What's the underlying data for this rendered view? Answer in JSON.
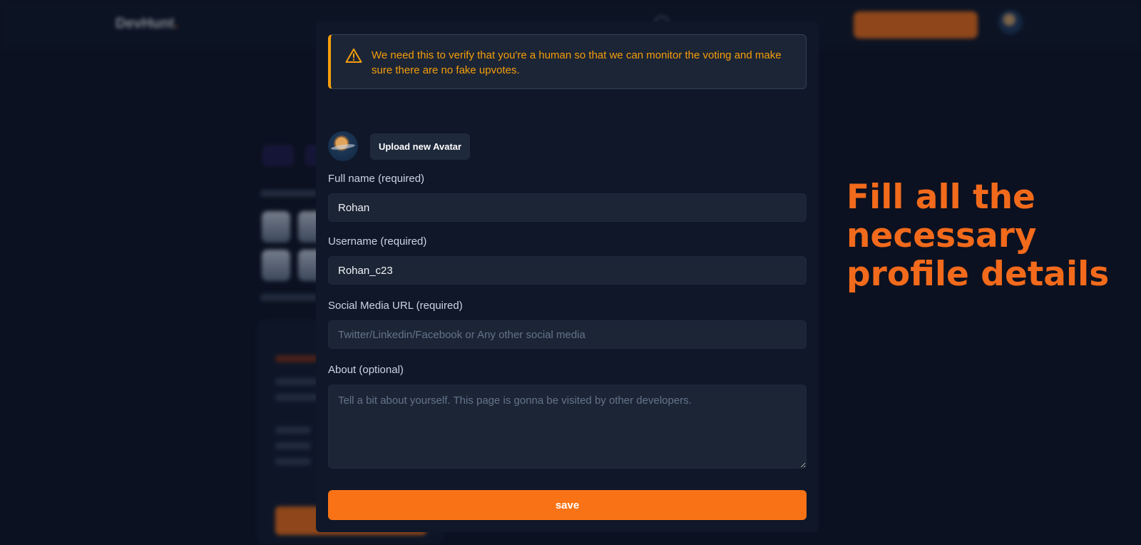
{
  "background": {
    "logo_main": "DevHunt",
    "logo_dot": "."
  },
  "modal": {
    "alert": {
      "icon": "warning-triangle-icon",
      "text": "We need this to verify that you're a human so that we can monitor the voting and make sure there are no fake upvotes."
    },
    "avatar": {
      "upload_label": "Upload new Avatar"
    },
    "fields": {
      "full_name": {
        "label": "Full name (required)",
        "value": "Rohan"
      },
      "username": {
        "label": "Username (required)",
        "value": "Rohan_c23"
      },
      "social": {
        "label": "Social Media URL (required)",
        "value": "",
        "placeholder": "Twitter/Linkedin/Facebook or Any other social media"
      },
      "about": {
        "label": "About (optional)",
        "value": "",
        "placeholder": "Tell a bit about yourself. This page is gonna be visited by other developers."
      }
    },
    "save_label": "save"
  },
  "caption": "Fill all the necessary profile details",
  "colors": {
    "accent": "#f97316",
    "warning": "#f59e0b",
    "background": "#0b1120",
    "modal": "#0f1729"
  }
}
